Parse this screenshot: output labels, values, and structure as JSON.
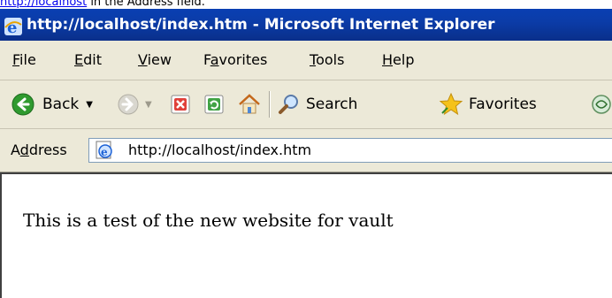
{
  "caption": {
    "link_text": "http://localhost",
    "rest_text": " in the Address field."
  },
  "window": {
    "title": "http://localhost/index.htm - Microsoft Internet Explorer"
  },
  "menu": {
    "file": {
      "u": "F",
      "rest": "ile"
    },
    "edit": {
      "u": "E",
      "rest": "dit"
    },
    "view": {
      "u": "V",
      "rest": "iew"
    },
    "favorites": {
      "pre": "F",
      "u": "a",
      "rest": "vorites"
    },
    "tools": {
      "u": "T",
      "rest": "ools"
    },
    "help": {
      "u": "H",
      "rest": "elp"
    }
  },
  "toolbar": {
    "back_label": "Back",
    "search_label": "Search",
    "favorites_label": "Favorites"
  },
  "address": {
    "label_pre": "A",
    "label_u": "d",
    "label_rest": "dress",
    "url": "http://localhost/index.htm"
  },
  "content": {
    "text": "This is a test of the new website for vault"
  },
  "colors": {
    "titlebar": "#0a3fb2",
    "chrome": "#ece9d8",
    "link": "#0000ee"
  },
  "icons": [
    "ie-icon",
    "back-arrow-icon",
    "forward-arrow-icon",
    "stop-icon",
    "refresh-icon",
    "home-icon",
    "search-icon",
    "favorites-star-icon",
    "media-icon",
    "page-icon"
  ]
}
